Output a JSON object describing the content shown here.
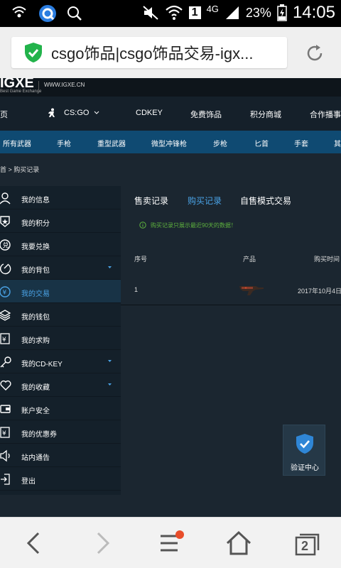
{
  "status_bar": {
    "network": "4G",
    "battery": "23%",
    "time": "14:05",
    "sim_badge": "1"
  },
  "browser": {
    "url_title": "csgo饰品|csgo饰品交易-igx...",
    "tab_count": "2"
  },
  "site": {
    "domain": "WWW.IGXE.CN",
    "logo_text": "IGXE",
    "logo_subtitle": "Best Game Exchange",
    "main_nav": {
      "game_select": "CS:GO",
      "cdkey": "CDKEY",
      "free_items": "免费饰品",
      "points_mall": "积分商城",
      "partner": "合作播事"
    },
    "categories": [
      "所有武器",
      "手枪",
      "重型武器",
      "微型冲锋枪",
      "步枪",
      "匕首",
      "手套",
      "其"
    ],
    "breadcrumb": "首 > 购买记录",
    "sidebar": [
      {
        "label": "我的信息",
        "icon": "user-icon"
      },
      {
        "label": "我的积分",
        "icon": "badge-icon"
      },
      {
        "label": "我要兑换",
        "icon": "exchange-icon"
      },
      {
        "label": "我的背包",
        "icon": "backpack-icon"
      },
      {
        "label": "我的交易",
        "icon": "yen-icon"
      },
      {
        "label": "我的钱包",
        "icon": "wallet-layers-icon"
      },
      {
        "label": "我的求购",
        "icon": "request-icon"
      },
      {
        "label": "我的CD-KEY",
        "icon": "key-icon"
      },
      {
        "label": "我的收藏",
        "icon": "heart-icon"
      },
      {
        "label": "账户安全",
        "icon": "security-icon"
      },
      {
        "label": "我的优惠券",
        "icon": "coupon-icon"
      },
      {
        "label": "站内通告",
        "icon": "speaker-icon"
      },
      {
        "label": "登出",
        "icon": "logout-icon"
      }
    ],
    "tabs": [
      "售卖记录",
      "购买记录",
      "自售模式交易"
    ],
    "notice": "购买记录只展示最近90天的数据！",
    "table": {
      "headers": [
        "序号",
        "产品",
        "购买时间"
      ],
      "rows": [
        {
          "index": "1",
          "product": "weapon",
          "date": "2017年10月4日"
        }
      ]
    },
    "verify_center": "验证中心"
  },
  "colors": {
    "accent_blue": "#4aa3e6",
    "category_bar": "#0f4a72",
    "notice_green": "#5eb33e",
    "shield_green": "#22b34b"
  }
}
